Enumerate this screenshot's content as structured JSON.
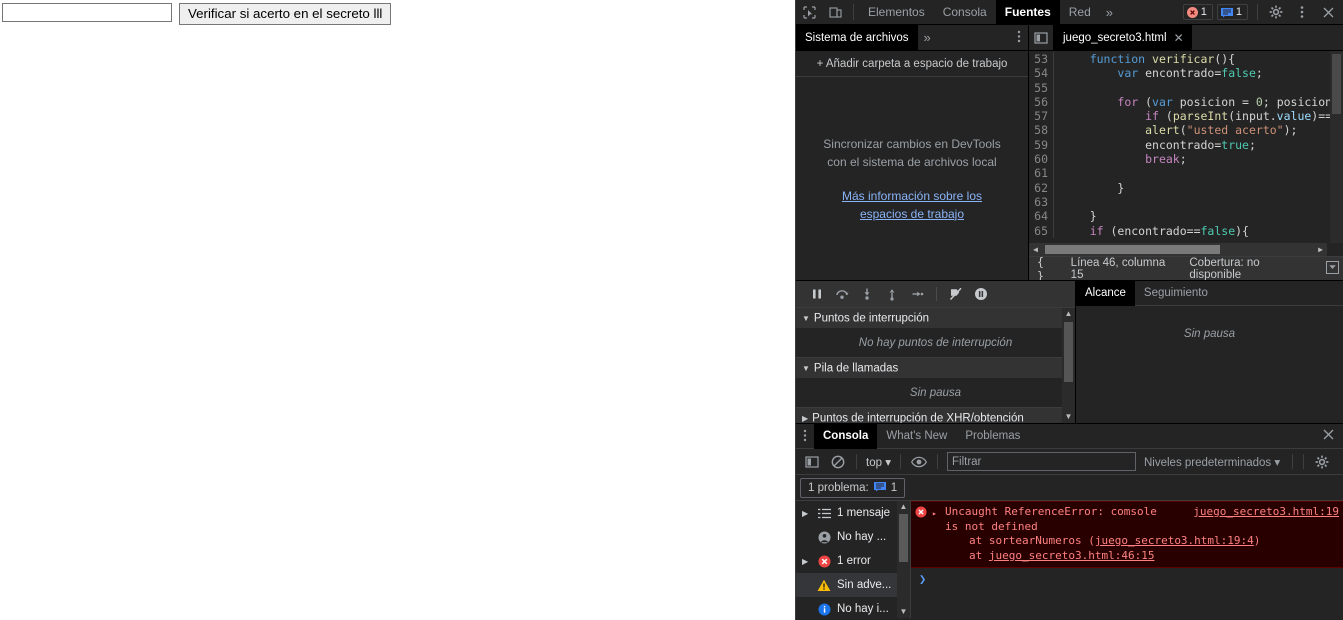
{
  "page": {
    "input_value": "",
    "input_placeholder": "",
    "verify_button": "Verificar si acerto en el secreto lll"
  },
  "devtools": {
    "toolbar": {
      "tabs": [
        {
          "label": "Elementos",
          "active": false
        },
        {
          "label": "Consola",
          "active": false
        },
        {
          "label": "Fuentes",
          "active": true
        },
        {
          "label": "Red",
          "active": false
        }
      ],
      "more_label": "»",
      "error_count": "1",
      "message_count": "1",
      "inspect_icon": "inspect-element-icon",
      "device_icon": "device-toolbar-icon",
      "settings_icon": "gear-icon",
      "menu_icon": "vertical-dots-icon",
      "close_icon": "close-icon"
    },
    "navigator": {
      "tabs": [
        {
          "label": "Sistema de archivos",
          "active": true
        }
      ],
      "more_label": "»",
      "menu_icon": "vertical-dots-icon",
      "add_folder": "+ Añadir carpeta a espacio de trabajo",
      "empty_message": "Sincronizar cambios en DevTools con el sistema de archivos local",
      "empty_link": "Más información sobre los espacios de trabajo"
    },
    "editor": {
      "panel_toggle_icon": "show-navigator-icon",
      "file_tab": "juego_secreto3.html",
      "close_icon": "close-icon",
      "code_lines": [
        {
          "num": "53",
          "tokens": [
            {
              "t": "    ",
              "c": "pl"
            },
            {
              "t": "function ",
              "c": "kw2"
            },
            {
              "t": "verificar",
              "c": "fn"
            },
            {
              "t": "(){",
              "c": "pl"
            }
          ]
        },
        {
          "num": "54",
          "tokens": [
            {
              "t": "        ",
              "c": "pl"
            },
            {
              "t": "var ",
              "c": "kw2"
            },
            {
              "t": "encontrado=",
              "c": "pl"
            },
            {
              "t": "false",
              "c": "lit"
            },
            {
              "t": ";",
              "c": "pl"
            }
          ]
        },
        {
          "num": "55",
          "tokens": []
        },
        {
          "num": "56",
          "tokens": [
            {
              "t": "        ",
              "c": "pl"
            },
            {
              "t": "for ",
              "c": "kw"
            },
            {
              "t": "(",
              "c": "pl"
            },
            {
              "t": "var ",
              "c": "kw2"
            },
            {
              "t": "posicion = ",
              "c": "pl"
            },
            {
              "t": "0",
              "c": "num"
            },
            {
              "t": "; posicion ",
              "c": "pl"
            },
            {
              "t": "◂",
              "c": "pl"
            }
          ]
        },
        {
          "num": "57",
          "tokens": [
            {
              "t": "            ",
              "c": "pl"
            },
            {
              "t": "if ",
              "c": "kw"
            },
            {
              "t": "(",
              "c": "pl"
            },
            {
              "t": "parseInt",
              "c": "fn"
            },
            {
              "t": "(input.",
              "c": "pl"
            },
            {
              "t": "value",
              "c": "var"
            },
            {
              "t": ")==se",
              "c": "pl"
            }
          ]
        },
        {
          "num": "58",
          "tokens": [
            {
              "t": "            ",
              "c": "pl"
            },
            {
              "t": "alert",
              "c": "fn"
            },
            {
              "t": "(",
              "c": "pl"
            },
            {
              "t": "\"usted acerto\"",
              "c": "str"
            },
            {
              "t": ");",
              "c": "pl"
            }
          ]
        },
        {
          "num": "59",
          "tokens": [
            {
              "t": "            ",
              "c": "pl"
            },
            {
              "t": "encontrado=",
              "c": "pl"
            },
            {
              "t": "true",
              "c": "lit"
            },
            {
              "t": ";",
              "c": "pl"
            }
          ]
        },
        {
          "num": "60",
          "tokens": [
            {
              "t": "            ",
              "c": "pl"
            },
            {
              "t": "break",
              "c": "kw"
            },
            {
              "t": ";",
              "c": "pl"
            }
          ]
        },
        {
          "num": "61",
          "tokens": []
        },
        {
          "num": "62",
          "tokens": [
            {
              "t": "        }",
              "c": "pl"
            }
          ]
        },
        {
          "num": "63",
          "tokens": []
        },
        {
          "num": "64",
          "tokens": [
            {
              "t": "    }",
              "c": "pl"
            }
          ]
        },
        {
          "num": "65",
          "tokens": [
            {
              "t": "    ",
              "c": "pl"
            },
            {
              "t": "if ",
              "c": "kw"
            },
            {
              "t": "(encontrado==",
              "c": "pl"
            },
            {
              "t": "false",
              "c": "lit"
            },
            {
              "t": "){",
              "c": "pl"
            }
          ]
        }
      ],
      "status": {
        "format_icon": "pretty-print-braces-icon",
        "position": "Línea 46, columna 15",
        "coverage": "Cobertura: no disponible",
        "right_icon": "bottom-drawer-icon"
      }
    },
    "debugger": {
      "controls": [
        {
          "name": "resume-script-icon"
        },
        {
          "name": "step-over-icon"
        },
        {
          "name": "step-into-icon"
        },
        {
          "name": "step-out-icon"
        },
        {
          "name": "step-icon"
        },
        {
          "name": "deactivate-breakpoints-icon"
        },
        {
          "name": "pause-on-exceptions-icon"
        }
      ],
      "sections": [
        {
          "title": "Puntos de interrupción",
          "expanded": true,
          "body": "No hay puntos de interrupción"
        },
        {
          "title": "Pila de llamadas",
          "expanded": true,
          "body": "Sin pausa"
        },
        {
          "title": "Puntos de interrupción de XHR/obtención",
          "expanded": false,
          "body": ""
        }
      ],
      "scope_tabs": [
        {
          "label": "Alcance",
          "active": true
        },
        {
          "label": "Seguimiento",
          "active": false
        }
      ],
      "scope_body": "Sin pausa"
    },
    "drawer": {
      "menu_icon": "vertical-dots-icon",
      "tabs": [
        {
          "label": "Consola",
          "active": true
        },
        {
          "label": "What's New",
          "active": false
        },
        {
          "label": "Problemas",
          "active": false
        }
      ],
      "close_icon": "close-icon",
      "console_toolbar": {
        "sidebar_toggle_icon": "show-console-sidebar-icon",
        "clear_icon": "clear-console-icon",
        "context": "top",
        "eye_icon": "live-expression-icon",
        "filter_placeholder": "Filtrar",
        "filter_value": "",
        "levels": "Niveles predeterminados",
        "settings_icon": "gear-icon"
      },
      "problem_bar": {
        "label": "1 problema:",
        "count": "1",
        "icon": "issue-message-icon"
      },
      "sidebar_items": [
        {
          "label": "1 mensaje",
          "icon": "list-icon",
          "arrow": true,
          "selected": false
        },
        {
          "label": "No hay ...",
          "icon": "user-message-icon",
          "arrow": false,
          "selected": false
        },
        {
          "label": "1 error",
          "icon": "error-icon",
          "arrow": true,
          "selected": false
        },
        {
          "label": "Sin adve...",
          "icon": "warning-icon",
          "arrow": false,
          "selected": true
        },
        {
          "label": "No hay i...",
          "icon": "info-icon",
          "arrow": false,
          "selected": false
        }
      ],
      "error": {
        "icon": "error-icon",
        "expand_arrow": "▸",
        "text_line1": "Uncaught ReferenceError: comsole",
        "text_line2": "is not defined",
        "source_link": "juego_secreto3.html:19",
        "stack": [
          {
            "prefix": "at sortearNumeros (",
            "link": "juego_secreto3.html:19:4",
            "suffix": ")"
          },
          {
            "prefix": "at ",
            "link": "juego_secreto3.html:46:15",
            "suffix": ""
          }
        ]
      },
      "prompt_chevron": "❯"
    }
  },
  "colors": {
    "bg": "#242424",
    "toolbar_bg": "#333333",
    "active_tab_bg": "#000000",
    "text": "#e8eaed",
    "muted": "#9aa0a6",
    "link": "#8ab4f8",
    "error_bg": "#290000",
    "error_text": "#ff8080",
    "error_dot": "#f28b82",
    "warning": "#fbbc04",
    "info": "#1a73e8"
  }
}
